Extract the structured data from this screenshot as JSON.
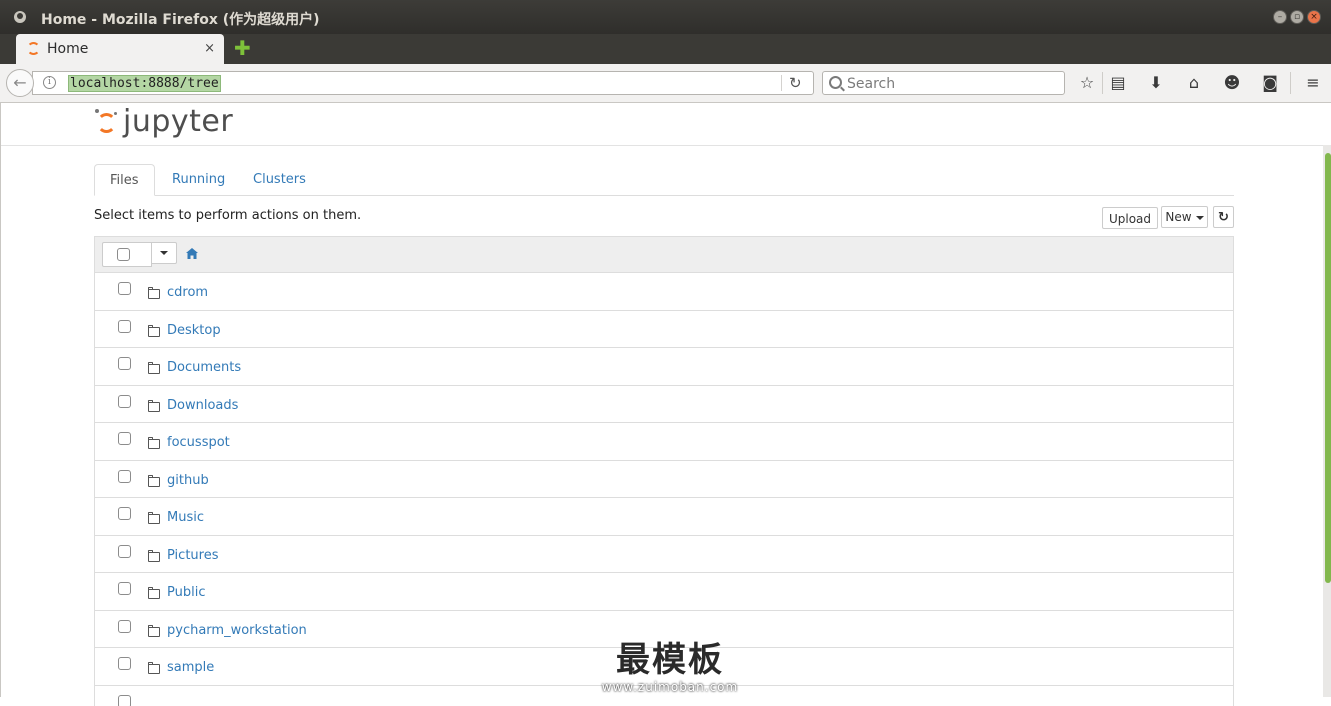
{
  "window": {
    "title": "Home - Mozilla Firefox (作为超级用户)"
  },
  "browser": {
    "tab_label": "Home",
    "tab_close": "×",
    "new_tab": "✚",
    "url": "localhost:8888/tree",
    "search_placeholder": "Search"
  },
  "jupyter": {
    "logo_text": "jupyter",
    "tabs": [
      {
        "label": "Files",
        "active": true
      },
      {
        "label": "Running",
        "active": false
      },
      {
        "label": "Clusters",
        "active": false
      }
    ],
    "hint": "Select items to perform actions on them.",
    "upload_label": "Upload",
    "new_label": "New",
    "items": [
      {
        "name": "cdrom",
        "type": "folder"
      },
      {
        "name": "Desktop",
        "type": "folder"
      },
      {
        "name": "Documents",
        "type": "folder"
      },
      {
        "name": "Downloads",
        "type": "folder"
      },
      {
        "name": "focusspot",
        "type": "folder"
      },
      {
        "name": "github",
        "type": "folder"
      },
      {
        "name": "Music",
        "type": "folder"
      },
      {
        "name": "Pictures",
        "type": "folder"
      },
      {
        "name": "Public",
        "type": "folder"
      },
      {
        "name": "pycharm_workstation",
        "type": "folder"
      },
      {
        "name": "sample",
        "type": "folder"
      }
    ]
  },
  "watermark": {
    "main": "最模板",
    "sub": "www.zuimoban.com"
  },
  "colors": {
    "link": "#337ab7",
    "jupyter_orange": "#f37726",
    "url_highlight": "#b4d6a4",
    "scroll_thumb": "#82b74d"
  }
}
